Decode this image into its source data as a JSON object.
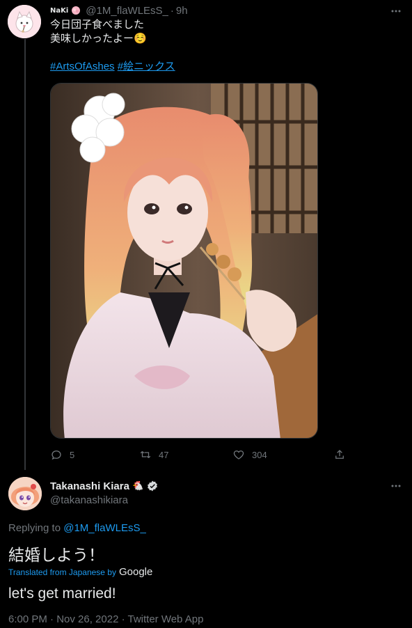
{
  "parent_tweet": {
    "display_name": "NaKi",
    "handle": "@1M_flaWLEsS_",
    "separator": "·",
    "time": "9h",
    "text_line1": "今日団子食べました",
    "text_line2": "美味しかったよー",
    "emoji": "☺️",
    "hashtags": [
      "#ArtsOfAshes",
      "#絵ニックス"
    ],
    "actions": {
      "replies": "5",
      "retweets": "47",
      "likes": "304"
    },
    "icons": {
      "more": "more-icon",
      "reply": "reply-icon",
      "retweet": "retweet-icon",
      "like": "heart-icon",
      "share": "share-icon"
    }
  },
  "reply_tweet": {
    "display_name": "Takanashi Kiara",
    "name_emoji": "🐔",
    "verified": true,
    "handle": "@takanashikiara",
    "replying_prefix": "Replying to",
    "replying_to": "@1M_flaWLEsS_",
    "text": "結婚しよう！",
    "translated_label": "Translated from Japanese by",
    "translator": "Google",
    "translation": "let's get married!",
    "meta": "6:00 PM · Nov 26, 2022 · Twitter Web App"
  },
  "colors": {
    "background": "#000000",
    "text_primary": "#e7e9ea",
    "text_secondary": "#71767b",
    "accent": "#1d9bf0",
    "thread_line": "#333639"
  }
}
